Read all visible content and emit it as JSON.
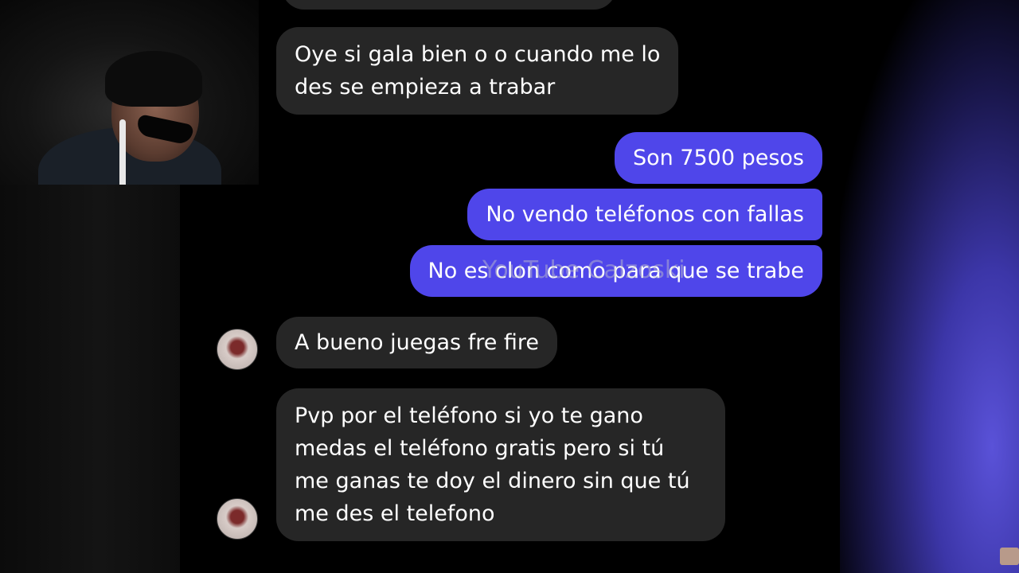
{
  "messages": {
    "m1": "Oye si gala bien o o cuando me lo",
    "m1b": "des se empieza a trabar",
    "m2": "Son 7500 pesos",
    "m3": "No vendo teléfonos con fallas",
    "m4": "No es clon como para que se trabe",
    "m5": "A bueno juegas fre fire",
    "m6": "Pvp por el teléfono si yo te gano",
    "m6b": "medas el teléfono gratis pero si tú",
    "m6c": "me ganas te doy el dinero sin que tú",
    "m6d": "me des el telefono"
  },
  "watermark": "YouTube Calzoski",
  "colors": {
    "incoming_bubble": "#262626",
    "outgoing_bubble": "#4f46ea",
    "background": "#000000"
  }
}
